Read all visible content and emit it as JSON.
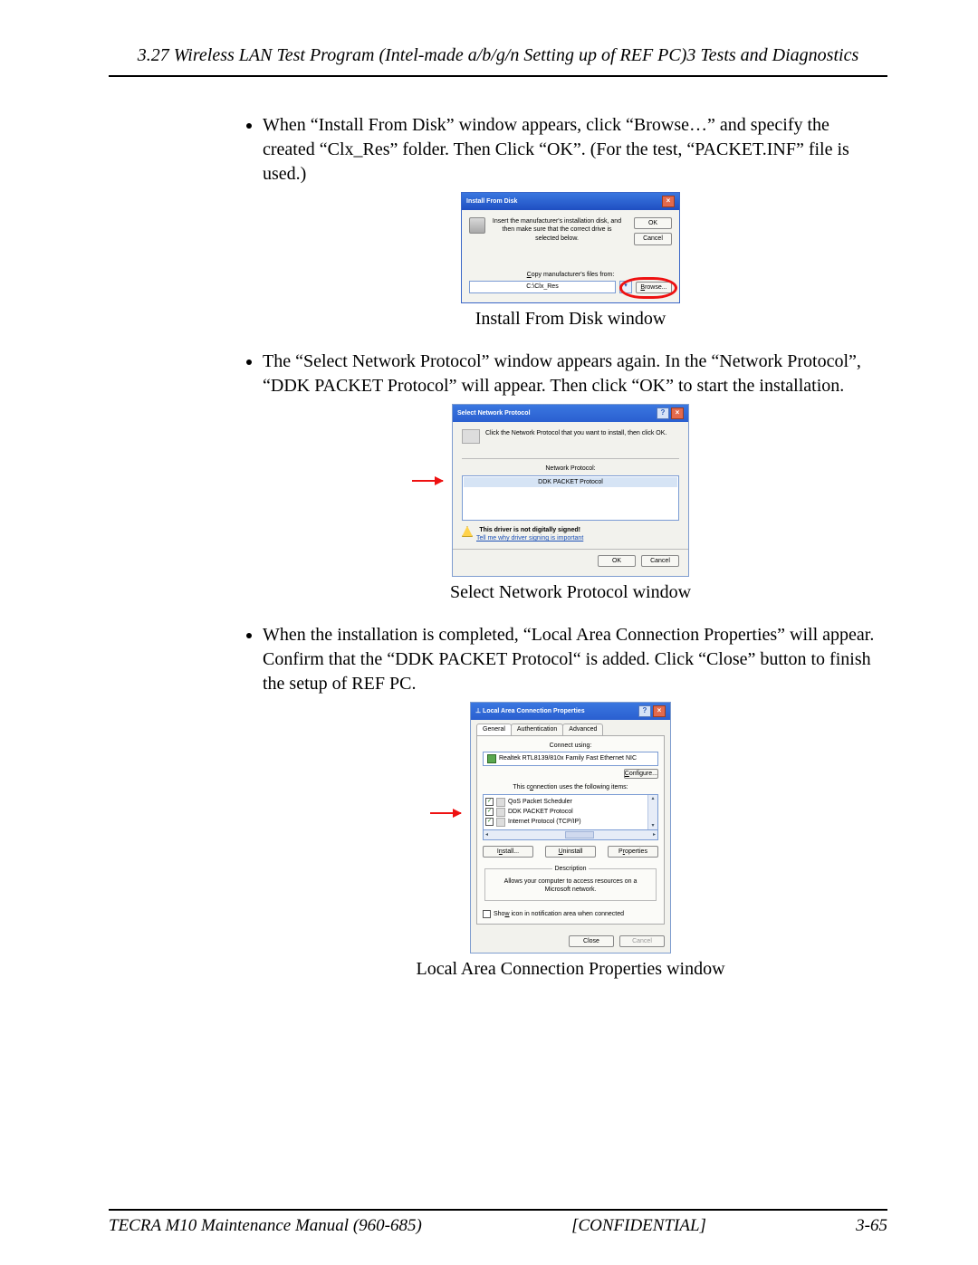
{
  "header": "3.27 Wireless LAN Test Program (Intel-made a/b/g/n Setting up of REF PC)3 Tests and Diagnostics",
  "bullets": {
    "b1": "When “Install From Disk” window appears, click “Browse…” and specify the created “Clx_Res” folder. Then Click “OK”. (For the test, “PACKET.INF” file is used.)",
    "b2": "The “Select Network Protocol” window appears again. In the “Network Protocol”, “DDK PACKET Protocol” will appear. Then click “OK” to start the installation.",
    "b3": "When the installation is completed, “Local Area Connection Properties” will appear. Confirm that the “DDK PACKET Protocol“ is added. Click “Close” button to finish the setup of REF PC."
  },
  "captions": {
    "c1": "Install From Disk window",
    "c2": "Select Network Protocol window",
    "c3": "Local Area Connection Properties window"
  },
  "dlg1": {
    "title": "Install From Disk",
    "msg": "Insert the manufacturer's installation disk, and then make sure that the correct drive is selected below.",
    "ok": "OK",
    "cancel": "Cancel",
    "copy_label": "Copy manufacturer's files from:",
    "path": "C:\\Clx_Res",
    "browse": "Browse..."
  },
  "dlg2": {
    "title": "Select Network Protocol",
    "intro": "Click the Network Protocol that you want to install, then click OK.",
    "np_label": "Network Protocol:",
    "item": "DDK PACKET Protocol",
    "warn": "This driver is not digitally signed!",
    "link": "Tell me why driver signing is important",
    "ok": "OK",
    "cancel": "Cancel"
  },
  "dlg3": {
    "title": "Local Area Connection Properties",
    "tabs": {
      "t1": "General",
      "t2": "Authentication",
      "t3": "Advanced"
    },
    "connect_label": "Connect using:",
    "nic": "Realtek RTL8139/810x Family Fast Ethernet NIC",
    "configure": "Configure...",
    "uses_label": "This connection uses the following items:",
    "items": {
      "i1": "QoS Packet Scheduler",
      "i2": "DDK PACKET Protocol",
      "i3": "Internet Protocol (TCP/IP)"
    },
    "install": "Install...",
    "uninstall": "Uninstall",
    "properties": "Properties",
    "desc_legend": "Description",
    "desc_text": "Allows your computer to access resources on a Microsoft network.",
    "show_icon": "Show icon in notification area when connected",
    "close": "Close",
    "cancel": "Cancel"
  },
  "footer": {
    "left": "TECRA M10 Maintenance Manual (960-685)",
    "center": "[CONFIDENTIAL]",
    "right": "3-65"
  }
}
